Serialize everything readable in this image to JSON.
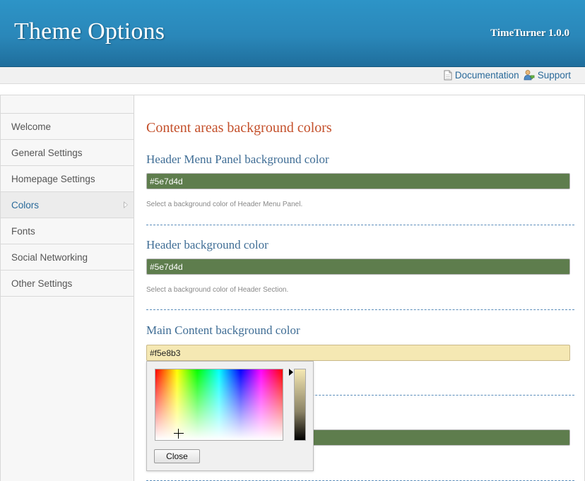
{
  "header": {
    "title": "Theme Options",
    "version": "TimeTurner 1.0.0"
  },
  "subbar": {
    "documentation_label": "Documentation",
    "support_label": "Support"
  },
  "sidebar": {
    "items": [
      {
        "label": "Welcome"
      },
      {
        "label": "General Settings"
      },
      {
        "label": "Homepage Settings"
      },
      {
        "label": "Colors",
        "active": true
      },
      {
        "label": "Fonts"
      },
      {
        "label": "Social Networking"
      },
      {
        "label": "Other Settings"
      }
    ]
  },
  "content": {
    "section_title": "Content areas background colors",
    "options": [
      {
        "label": "Header Menu Panel background color",
        "value": "#5e7d4d",
        "help": "Select a background color of Header Menu Panel."
      },
      {
        "label": "Header background color",
        "value": "#5e7d4d",
        "help": "Select a background color of Header Section."
      },
      {
        "label": "Main Content background color",
        "value": "#f5e8b3",
        "help": "."
      },
      {
        "value": "#5e7d4d"
      }
    ]
  },
  "picker": {
    "close_label": "Close"
  },
  "colors": {
    "header_blue": "#2a87b9",
    "accent_orange": "#c4502b",
    "label_blue": "#3f6d95",
    "green_swatch": "#5e7d4d",
    "cream_swatch": "#f5e8b3"
  }
}
